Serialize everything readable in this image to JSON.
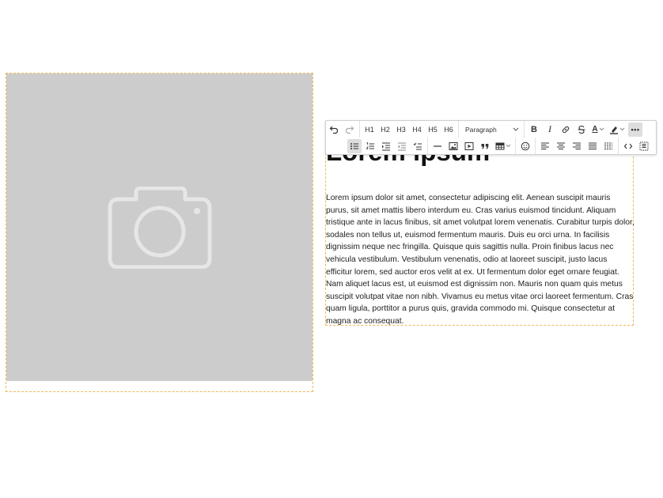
{
  "content": {
    "heading": "Lorem ipsum",
    "paragraph": "Lorem ipsum dolor sit amet, consectetur adipiscing elit. Aenean suscipit mauris purus, sit amet mattis libero interdum eu. Cras varius euismod tincidunt. Aliquam tristique ante in lacus finibus, sit amet volutpat lorem venenatis. Curabitur turpis dolor, sodales non tellus ut, euismod fermentum mauris. Duis eu orci urna. In facilisis dignissim neque nec fringilla. Quisque quis sagittis nulla. Proin finibus lacus nec vehicula vestibulum. Vestibulum venenatis, odio at laoreet suscipit, justo lacus efficitur lorem, sed auctor eros velit at ex. Ut fermentum dolor eget ornare feugiat. Nam aliquet lacus est, ut euismod est dignissim non. Mauris non quam quis metus suscipit volutpat vitae non nibh. Vivamus eu metus vitae orci laoreet fermentum. Cras quam ligula, porttitor a purus quis, gravida commodo mi. Quisque consectetur at magna ac consequat."
  },
  "image": {
    "icon": "camera-icon"
  },
  "colors": {
    "placeholder_bg": "#cccccc",
    "block_outline": "#f0b95a",
    "active_button": "#dedede"
  },
  "toolbar": {
    "headings": [
      "H1",
      "H2",
      "H3",
      "H4",
      "H5",
      "H6"
    ],
    "paragraph_select": "Paragraph",
    "bold": "B",
    "italic": "I",
    "text_color": "A",
    "more": "•••"
  }
}
